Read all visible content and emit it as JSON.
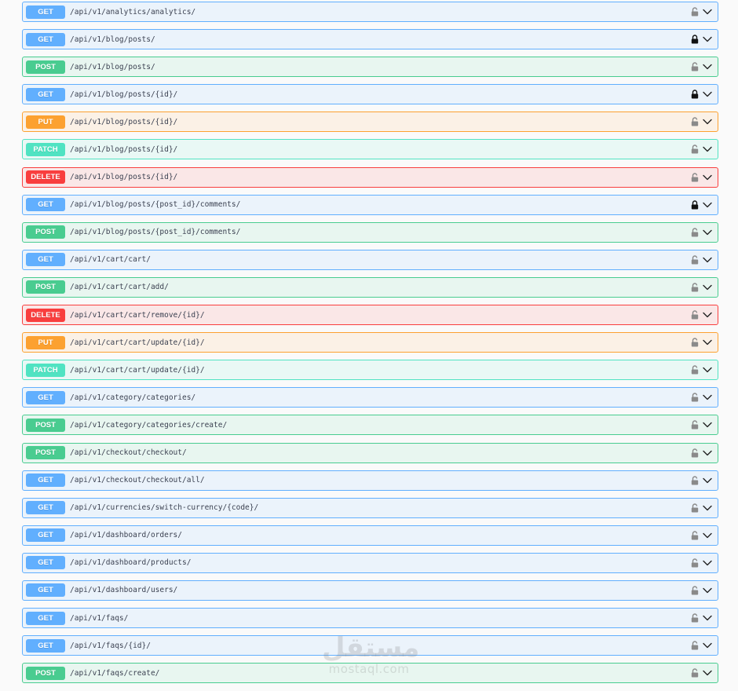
{
  "colors": {
    "GET": "#61affe",
    "POST": "#49cc90",
    "PUT": "#fca130",
    "PATCH": "#50e3c2",
    "DELETE": "#f93e3e",
    "lock_unlocked": "#8a8a8a",
    "lock_locked": "#111111"
  },
  "operations": [
    {
      "method": "GET",
      "path": "/api/v1/analytics/analytics/",
      "locked": false
    },
    {
      "method": "GET",
      "path": "/api/v1/blog/posts/",
      "locked": true
    },
    {
      "method": "POST",
      "path": "/api/v1/blog/posts/",
      "locked": false
    },
    {
      "method": "GET",
      "path": "/api/v1/blog/posts/{id}/",
      "locked": true
    },
    {
      "method": "PUT",
      "path": "/api/v1/blog/posts/{id}/",
      "locked": false
    },
    {
      "method": "PATCH",
      "path": "/api/v1/blog/posts/{id}/",
      "locked": false
    },
    {
      "method": "DELETE",
      "path": "/api/v1/blog/posts/{id}/",
      "locked": false
    },
    {
      "method": "GET",
      "path": "/api/v1/blog/posts/{post_id}/comments/",
      "locked": true
    },
    {
      "method": "POST",
      "path": "/api/v1/blog/posts/{post_id}/comments/",
      "locked": false
    },
    {
      "method": "GET",
      "path": "/api/v1/cart/cart/",
      "locked": false
    },
    {
      "method": "POST",
      "path": "/api/v1/cart/cart/add/",
      "locked": false
    },
    {
      "method": "DELETE",
      "path": "/api/v1/cart/cart/remove/{id}/",
      "locked": false
    },
    {
      "method": "PUT",
      "path": "/api/v1/cart/cart/update/{id}/",
      "locked": false
    },
    {
      "method": "PATCH",
      "path": "/api/v1/cart/cart/update/{id}/",
      "locked": false
    },
    {
      "method": "GET",
      "path": "/api/v1/category/categories/",
      "locked": false
    },
    {
      "method": "POST",
      "path": "/api/v1/category/categories/create/",
      "locked": false
    },
    {
      "method": "POST",
      "path": "/api/v1/checkout/checkout/",
      "locked": false
    },
    {
      "method": "GET",
      "path": "/api/v1/checkout/checkout/all/",
      "locked": false
    },
    {
      "method": "GET",
      "path": "/api/v1/currencies/switch-currency/{code}/",
      "locked": false
    },
    {
      "method": "GET",
      "path": "/api/v1/dashboard/orders/",
      "locked": false
    },
    {
      "method": "GET",
      "path": "/api/v1/dashboard/products/",
      "locked": false
    },
    {
      "method": "GET",
      "path": "/api/v1/dashboard/users/",
      "locked": false
    },
    {
      "method": "GET",
      "path": "/api/v1/faqs/",
      "locked": false
    },
    {
      "method": "GET",
      "path": "/api/v1/faqs/{id}/",
      "locked": false
    },
    {
      "method": "POST",
      "path": "/api/v1/faqs/create/",
      "locked": false
    }
  ],
  "icons": {
    "lock": "lock-icon",
    "expand": "chevron-down-icon"
  },
  "watermark": {
    "logo": "مستقل",
    "url": "mostaql.com"
  }
}
